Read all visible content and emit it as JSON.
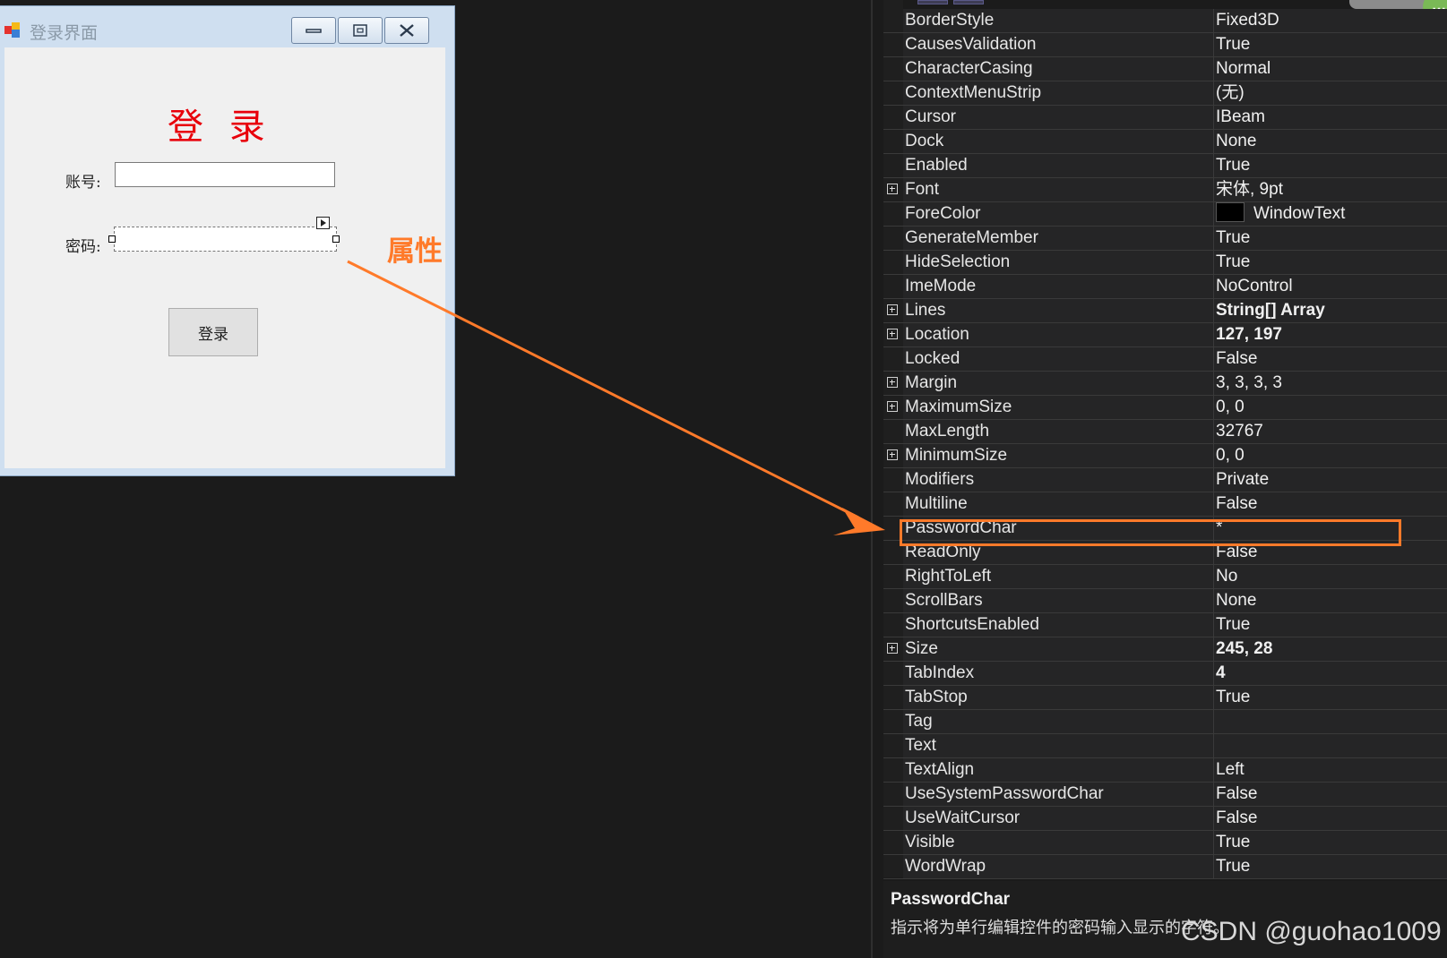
{
  "login_window": {
    "title": "登录界面",
    "heading": "登 录",
    "account_label": "账号:",
    "account_value": "",
    "password_label": "密码:",
    "password_value": "",
    "login_button": "登录"
  },
  "annotation": {
    "callout_text": "属性",
    "color": "#ff7a2a"
  },
  "properties": [
    {
      "name": "BorderStyle",
      "value": "Fixed3D",
      "expandable": false,
      "bold": false
    },
    {
      "name": "CausesValidation",
      "value": "True",
      "expandable": false,
      "bold": false
    },
    {
      "name": "CharacterCasing",
      "value": "Normal",
      "expandable": false,
      "bold": false
    },
    {
      "name": "ContextMenuStrip",
      "value": "(无)",
      "expandable": false,
      "bold": false
    },
    {
      "name": "Cursor",
      "value": "IBeam",
      "expandable": false,
      "bold": false
    },
    {
      "name": "Dock",
      "value": "None",
      "expandable": false,
      "bold": false
    },
    {
      "name": "Enabled",
      "value": "True",
      "expandable": false,
      "bold": false
    },
    {
      "name": "Font",
      "value": "宋体, 9pt",
      "expandable": true,
      "bold": false
    },
    {
      "name": "ForeColor",
      "value": "WindowText",
      "expandable": false,
      "bold": false,
      "swatch": "#000000"
    },
    {
      "name": "GenerateMember",
      "value": "True",
      "expandable": false,
      "bold": false
    },
    {
      "name": "HideSelection",
      "value": "True",
      "expandable": false,
      "bold": false
    },
    {
      "name": "ImeMode",
      "value": "NoControl",
      "expandable": false,
      "bold": false
    },
    {
      "name": "Lines",
      "value": "String[] Array",
      "expandable": true,
      "bold": true
    },
    {
      "name": "Location",
      "value": "127, 197",
      "expandable": true,
      "bold": true
    },
    {
      "name": "Locked",
      "value": "False",
      "expandable": false,
      "bold": false
    },
    {
      "name": "Margin",
      "value": "3, 3, 3, 3",
      "expandable": true,
      "bold": false
    },
    {
      "name": "MaximumSize",
      "value": "0, 0",
      "expandable": true,
      "bold": false
    },
    {
      "name": "MaxLength",
      "value": "32767",
      "expandable": false,
      "bold": false
    },
    {
      "name": "MinimumSize",
      "value": "0, 0",
      "expandable": true,
      "bold": false
    },
    {
      "name": "Modifiers",
      "value": "Private",
      "expandable": false,
      "bold": false
    },
    {
      "name": "Multiline",
      "value": "False",
      "expandable": false,
      "bold": false
    },
    {
      "name": "PasswordChar",
      "value": "*",
      "expandable": false,
      "bold": false,
      "highlighted": true
    },
    {
      "name": "ReadOnly",
      "value": "False",
      "expandable": false,
      "bold": false
    },
    {
      "name": "RightToLeft",
      "value": "No",
      "expandable": false,
      "bold": false
    },
    {
      "name": "ScrollBars",
      "value": "None",
      "expandable": false,
      "bold": false
    },
    {
      "name": "ShortcutsEnabled",
      "value": "True",
      "expandable": false,
      "bold": false
    },
    {
      "name": "Size",
      "value": "245, 28",
      "expandable": true,
      "bold": true
    },
    {
      "name": "TabIndex",
      "value": "4",
      "expandable": false,
      "bold": true
    },
    {
      "name": "TabStop",
      "value": "True",
      "expandable": false,
      "bold": false
    },
    {
      "name": "Tag",
      "value": "",
      "expandable": false,
      "bold": false
    },
    {
      "name": "Text",
      "value": "",
      "expandable": false,
      "bold": false
    },
    {
      "name": "TextAlign",
      "value": "Left",
      "expandable": false,
      "bold": false
    },
    {
      "name": "UseSystemPasswordChar",
      "value": "False",
      "expandable": false,
      "bold": false
    },
    {
      "name": "UseWaitCursor",
      "value": "False",
      "expandable": false,
      "bold": false
    },
    {
      "name": "Visible",
      "value": "True",
      "expandable": false,
      "bold": false
    },
    {
      "name": "WordWrap",
      "value": "True",
      "expandable": false,
      "bold": false
    }
  ],
  "description": {
    "title": "PasswordChar",
    "text": "指示将为单行编辑控件的密码输入显示的字符。"
  },
  "badge": "···",
  "watermark": "CSDN @guohao1009"
}
